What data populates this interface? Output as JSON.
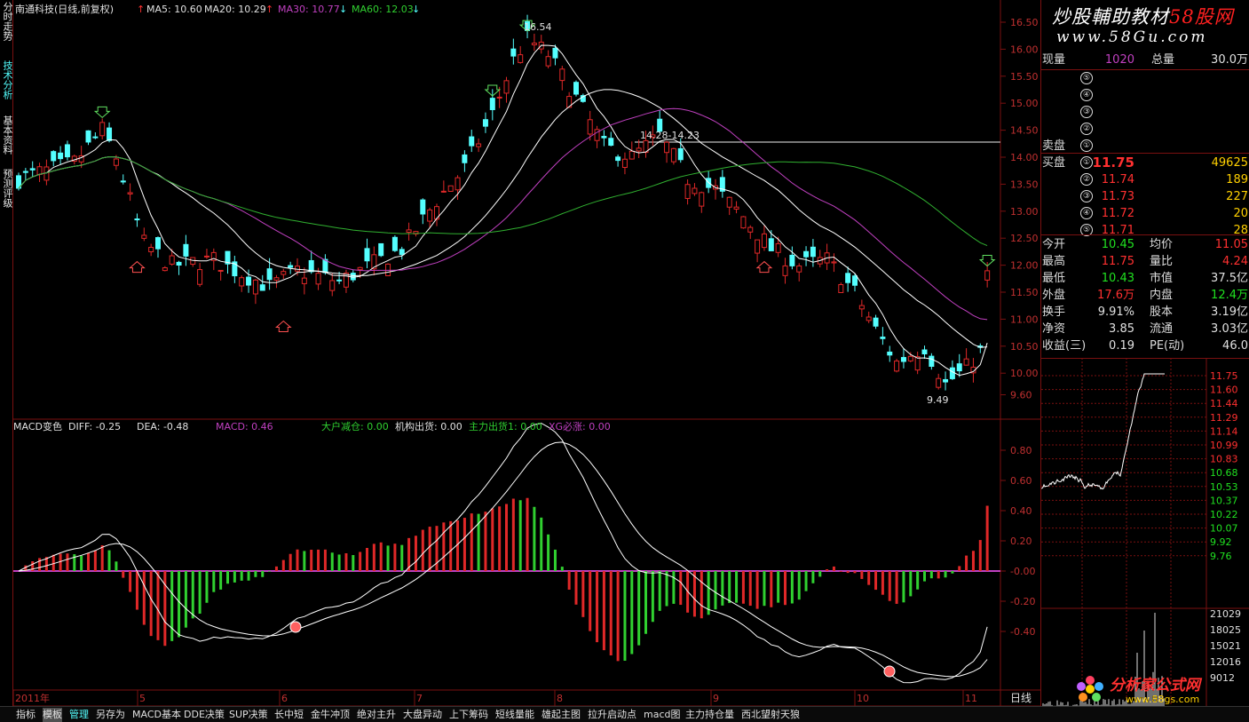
{
  "left_tabs": [
    "分时走势",
    "技术分析",
    "基本资料",
    "预测评级"
  ],
  "stock": {
    "title": "南通科技(日线,前复权)",
    "ma5_label": "MA5: 10.60",
    "ma20_label": "MA20: 10.29",
    "ma30_label": "MA30: 10.77",
    "ma60_label": "MA60: 12.03",
    "high_annot": "16.54",
    "low_annot": "9.49",
    "range_annot": "14.28-14.23",
    "ylabels": [
      "16.50",
      "16.00",
      "15.50",
      "15.00",
      "14.50",
      "14.00",
      "13.50",
      "13.00",
      "12.50",
      "12.00",
      "11.50",
      "11.00",
      "10.50",
      "10.00",
      "9.60"
    ]
  },
  "macd": {
    "title": "MACD变色",
    "diff_label": "DIFF: -0.25",
    "dea_label": "DEA: -0.48",
    "macd_label": "MACD: 0.46",
    "big_reduce": "大户减仓: 0.00",
    "inst_out": "机构出货: 0.00",
    "main_out": "主力出货1: 0.00",
    "xg_label": "XG必涨: 0.00",
    "ylabels": [
      "0.80",
      "0.60",
      "0.40",
      "0.20",
      "-0.00",
      "-0.20",
      "-0.40"
    ]
  },
  "xaxis": [
    "2011年",
    "5",
    "6",
    "7",
    "8",
    "9",
    "10",
    "11"
  ],
  "watermark": {
    "top": "炒股輔助教材",
    "top_red": "58股网",
    "url": "www.58Gu.com",
    "logo": "分析家公式网",
    "logo_url": "www.88gs.com"
  },
  "quote": {
    "xianliang_label": "现量",
    "xianliang": "1020",
    "zongliang_label": "总量",
    "zongliang": "30.0万",
    "sell_label": "卖盘",
    "buy_label": "买盘",
    "sell_levels": [
      "⑤",
      "④",
      "③",
      "②",
      "①"
    ],
    "buy_levels": [
      {
        "n": "①",
        "price": "11.75",
        "vol": "49625"
      },
      {
        "n": "②",
        "price": "11.74",
        "vol": "189"
      },
      {
        "n": "③",
        "price": "11.73",
        "vol": "227"
      },
      {
        "n": "④",
        "price": "11.72",
        "vol": "20"
      },
      {
        "n": "⑤",
        "price": "11.71",
        "vol": "28"
      }
    ],
    "stats": [
      {
        "l1": "今开",
        "v1": "10.45",
        "c1": "#20e020",
        "l2": "均价",
        "v2": "11.05",
        "c2": "#ff3030"
      },
      {
        "l1": "最高",
        "v1": "11.75",
        "c1": "#ff3030",
        "l2": "量比",
        "v2": "4.24",
        "c2": "#ff3030"
      },
      {
        "l1": "最低",
        "v1": "10.43",
        "c1": "#20e020",
        "l2": "市值",
        "v2": "37.5亿",
        "c2": "#e0e0e0"
      },
      {
        "l1": "外盘",
        "v1": "17.6万",
        "c1": "#ff3030",
        "l2": "内盘",
        "v2": "12.4万",
        "c2": "#20e020"
      },
      {
        "l1": "换手",
        "v1": "9.91%",
        "c1": "#e0e0e0",
        "l2": "股本",
        "v2": "3.19亿",
        "c2": "#e0e0e0"
      },
      {
        "l1": "净资",
        "v1": "3.85",
        "c1": "#e0e0e0",
        "l2": "流通",
        "v2": "3.03亿",
        "c2": "#e0e0e0"
      },
      {
        "l1": "收益(三)",
        "v1": "0.19",
        "c1": "#e0e0e0",
        "l2": "PE(动)",
        "v2": "46.0",
        "c2": "#e0e0e0"
      }
    ]
  },
  "minute": {
    "price_labels": [
      "11.75",
      "11.60",
      "11.44",
      "11.29",
      "11.14",
      "10.99",
      "10.83",
      "10.68",
      "10.53",
      "10.37",
      "10.22",
      "10.07",
      "9.92",
      "9.76"
    ],
    "vol_labels": [
      "21029",
      "18025",
      "15021",
      "12016",
      "9012"
    ]
  },
  "bottom_tabs": [
    "指标",
    "模板",
    "管理",
    "另存为",
    "MACD基本",
    "DDE决策",
    "SUP决策",
    "长中短",
    "金牛冲顶",
    "绝对主升",
    "大盘异动",
    "上下筹码",
    "短线量能",
    "雄起主图",
    "拉升启动点",
    "macd图",
    "主力持仓量",
    "西北望射天狼"
  ],
  "day_line": "日线",
  "nav_arrows": [
    "+",
    "◄",
    "►"
  ],
  "colors": {
    "up": "#e02828",
    "down": "#54ffff",
    "ma5": "#ffffff",
    "ma20": "#ffffff",
    "ma30": "#c040c0",
    "ma60": "#30b030",
    "grid": "#7a1010"
  }
}
